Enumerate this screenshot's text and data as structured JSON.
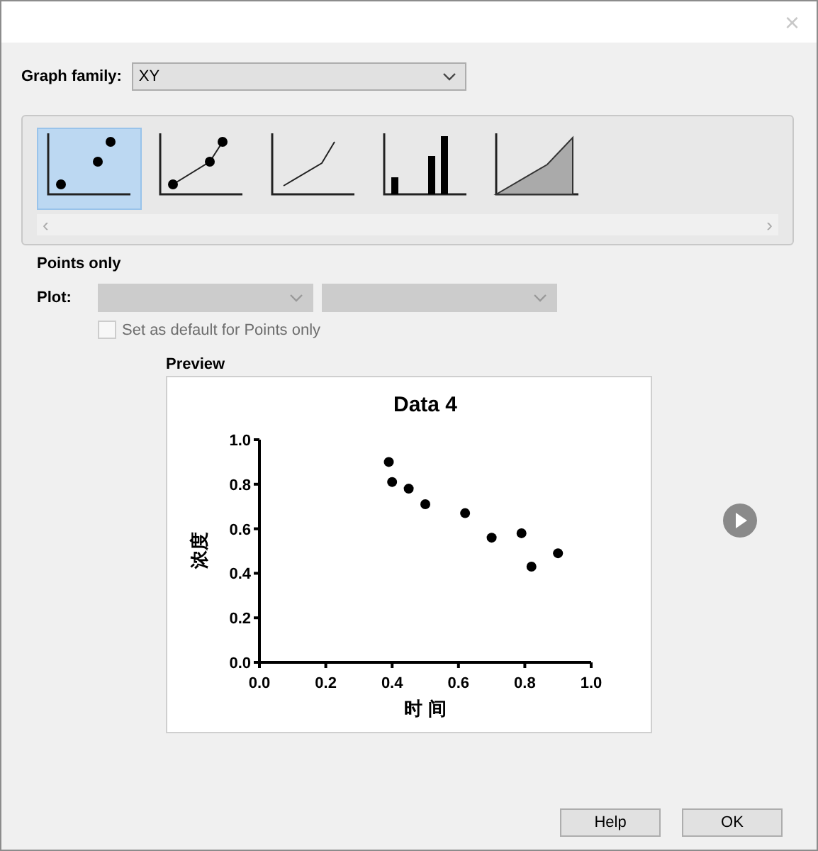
{
  "window": {
    "close": "×"
  },
  "graph_family": {
    "label": "Graph family:",
    "value": "XY"
  },
  "gallery": [
    {
      "kind": "points",
      "selected": true
    },
    {
      "kind": "points-line",
      "selected": false
    },
    {
      "kind": "line",
      "selected": false
    },
    {
      "kind": "bars",
      "selected": false
    },
    {
      "kind": "area",
      "selected": false
    }
  ],
  "gallery_scroll": {
    "left": "‹",
    "right": "›"
  },
  "section_title": "Points only",
  "plot": {
    "label": "Plot:",
    "disabled": true
  },
  "default_checkbox": {
    "label": "Set as default for Points only",
    "checked": false,
    "disabled": true
  },
  "preview": {
    "label": "Preview",
    "chart_data": {
      "type": "scatter",
      "title": "Data 4",
      "xlabel": "时 间",
      "ylabel": "浓度",
      "x": [
        0.39,
        0.4,
        0.45,
        0.5,
        0.62,
        0.7,
        0.79,
        0.82,
        0.9
      ],
      "series": [
        {
          "color": "#000000",
          "values": [
            0.9,
            0.81,
            0.78,
            0.71,
            0.67,
            0.56,
            0.58,
            0.43,
            0.49
          ]
        }
      ],
      "xlim": [
        0,
        1
      ],
      "ylim": [
        0,
        1
      ],
      "xticks": [
        {
          "value": 0,
          "label": "0.0"
        },
        {
          "value": 0.2,
          "label": "0.2"
        },
        {
          "value": 0.4,
          "label": "0.4"
        },
        {
          "value": 0.6,
          "label": "0.6"
        },
        {
          "value": 0.8,
          "label": "0.8"
        },
        {
          "value": 1,
          "label": "1.0"
        }
      ],
      "yticks": [
        {
          "value": 0,
          "label": "0.0"
        },
        {
          "value": 0.2,
          "label": "0.2"
        },
        {
          "value": 0.4,
          "label": "0.4"
        },
        {
          "value": 0.6,
          "label": "0.6"
        },
        {
          "value": 0.8,
          "label": "0.8"
        },
        {
          "value": 1,
          "label": "1.0"
        }
      ]
    }
  },
  "buttons": [
    "Help",
    "OK"
  ]
}
